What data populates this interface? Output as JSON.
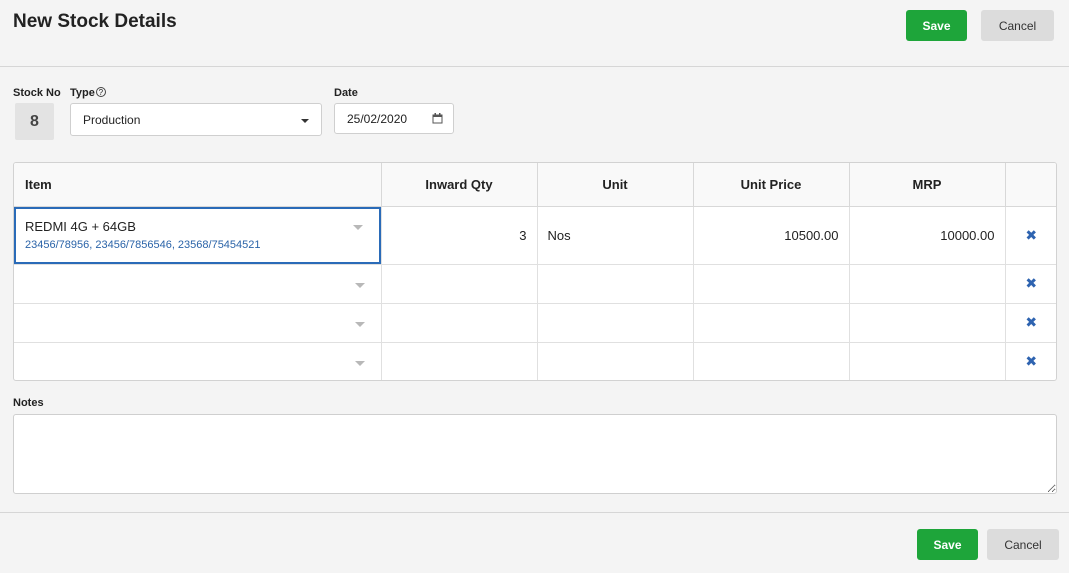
{
  "header": {
    "title": "New Stock Details",
    "save_label": "Save",
    "cancel_label": "Cancel"
  },
  "form": {
    "stock_no_label": "Stock No",
    "stock_no_value": "8",
    "type_label": "Type",
    "type_value": "Production",
    "date_label": "Date",
    "date_value": "25/02/2020"
  },
  "table": {
    "columns": [
      "Item",
      "Inward Qty",
      "Unit",
      "Unit Price",
      "MRP"
    ],
    "rows": [
      {
        "item": "REDMI 4G + 64GB",
        "serials": "23456/78956, 23456/7856546, 23568/75454521",
        "qty": "3",
        "unit": "Nos",
        "unit_price": "10500.00",
        "mrp": "10000.00"
      },
      {
        "item": "",
        "serials": "",
        "qty": "",
        "unit": "",
        "unit_price": "",
        "mrp": ""
      },
      {
        "item": "",
        "serials": "",
        "qty": "",
        "unit": "",
        "unit_price": "",
        "mrp": ""
      },
      {
        "item": "",
        "serials": "",
        "qty": "",
        "unit": "",
        "unit_price": "",
        "mrp": ""
      }
    ],
    "delete_icon": "✖"
  },
  "notes": {
    "label": "Notes",
    "value": ""
  },
  "footer": {
    "save_label": "Save",
    "cancel_label": "Cancel"
  },
  "colors": {
    "primary": "#1ea53a",
    "link": "#2a63a8",
    "active_border": "#2a6bb8"
  },
  "icons": {
    "help": "question-circle-icon",
    "calendar": "calendar-icon",
    "dropdown": "caret-down-icon",
    "delete": "times-icon"
  }
}
